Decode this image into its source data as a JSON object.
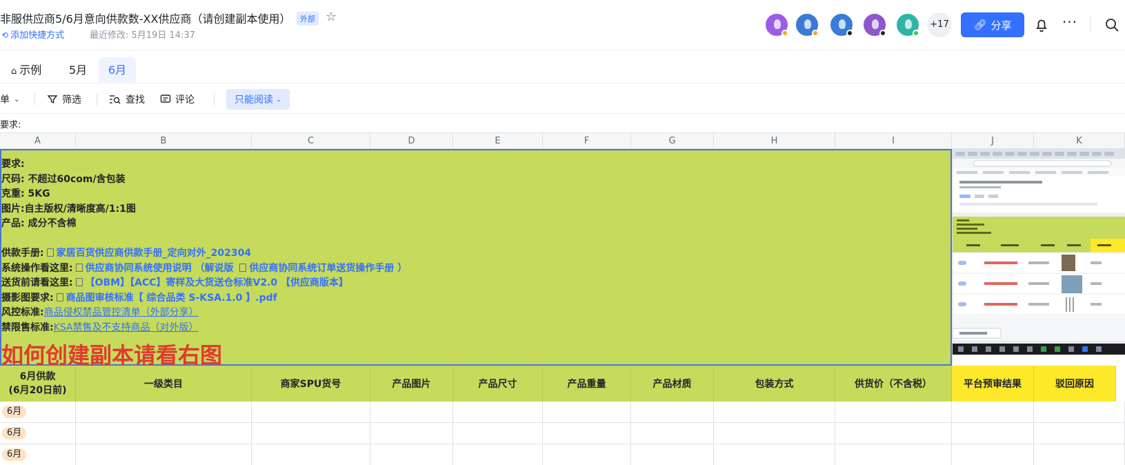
{
  "header": {
    "title": "非服供应商5/6月意向供款数-XX供应商（请创建副本使用）",
    "external_badge": "外部",
    "add_shortcut": "添加快捷方式",
    "last_edit": "最近修改: 5月19日 14:37",
    "collaborator_extra_count": "+17",
    "share_label": "分享"
  },
  "tabs": [
    {
      "label": "示例",
      "icon": "home-icon",
      "active": false
    },
    {
      "label": "5月",
      "active": false
    },
    {
      "label": "6月",
      "active": true
    }
  ],
  "toolbar": {
    "menu_label": "菜单",
    "filter_label": "筛选",
    "find_label": "查找",
    "comment_label": "评论",
    "readonly_label": "只能阅读"
  },
  "formula_bar": {
    "text": "要求:"
  },
  "columns": [
    "A",
    "B",
    "C",
    "D",
    "E",
    "F",
    "G",
    "H",
    "I",
    "J",
    "K"
  ],
  "info_block": {
    "lines": [
      {
        "label": "要求:",
        "text": ""
      },
      {
        "label": "尺码:",
        "text": "不超过60com/含包装"
      },
      {
        "label": "克重:",
        "text": "5KG"
      },
      {
        "label": "图片:",
        "text": "自主版权/清晰度高/1:1图"
      },
      {
        "label": "产品:",
        "text": "成分不含棉"
      },
      {
        "label": "",
        "text": ""
      },
      {
        "label": "供款手册:",
        "text": "家居百货供应商供款手册_定向对外_202304"
      },
      {
        "label": "系统操作看这里:",
        "text": "供应商协同系统使用说明 （解说版 ",
        "text2": "供应商协同系统订单送货操作手册 ）"
      },
      {
        "label": "送货前请看这里:",
        "text": "【OBM】【ACC】寄样及大货送仓标准V2.0 【供应商版本】"
      },
      {
        "label": "摄影图要求:",
        "text": "商品图审核标准【 综合品类 S-KSA.1.0 】.pdf"
      },
      {
        "label": "风控标准:",
        "text": "商品侵权禁品管控清单（外部分享）"
      },
      {
        "label": "禁限售标准:",
        "text": "KSA禁售及不支持商品（对外版）"
      }
    ],
    "headline": "如何创建副本请看右图"
  },
  "table_headers": [
    {
      "line1": "6月供款",
      "line2": "(6月20日前)"
    },
    {
      "line1": "一级类目"
    },
    {
      "line1": "商家SPU货号"
    },
    {
      "line1": "产品图片"
    },
    {
      "line1": "产品尺寸"
    },
    {
      "line1": "产品重量"
    },
    {
      "line1": "产品材质"
    },
    {
      "line1": "包装方式"
    },
    {
      "line1": "供货价（不含税）"
    },
    {
      "line1": "平台预审结果"
    },
    {
      "line1": "驳回原因"
    }
  ],
  "rows": [
    {
      "month": "6月"
    },
    {
      "month": "6月"
    },
    {
      "month": "6月"
    }
  ],
  "colors": {
    "accent": "#3370ff",
    "green_fill": "#c6da5c",
    "yellow_fill": "#fde82a",
    "headline_red": "#e03a2f"
  }
}
